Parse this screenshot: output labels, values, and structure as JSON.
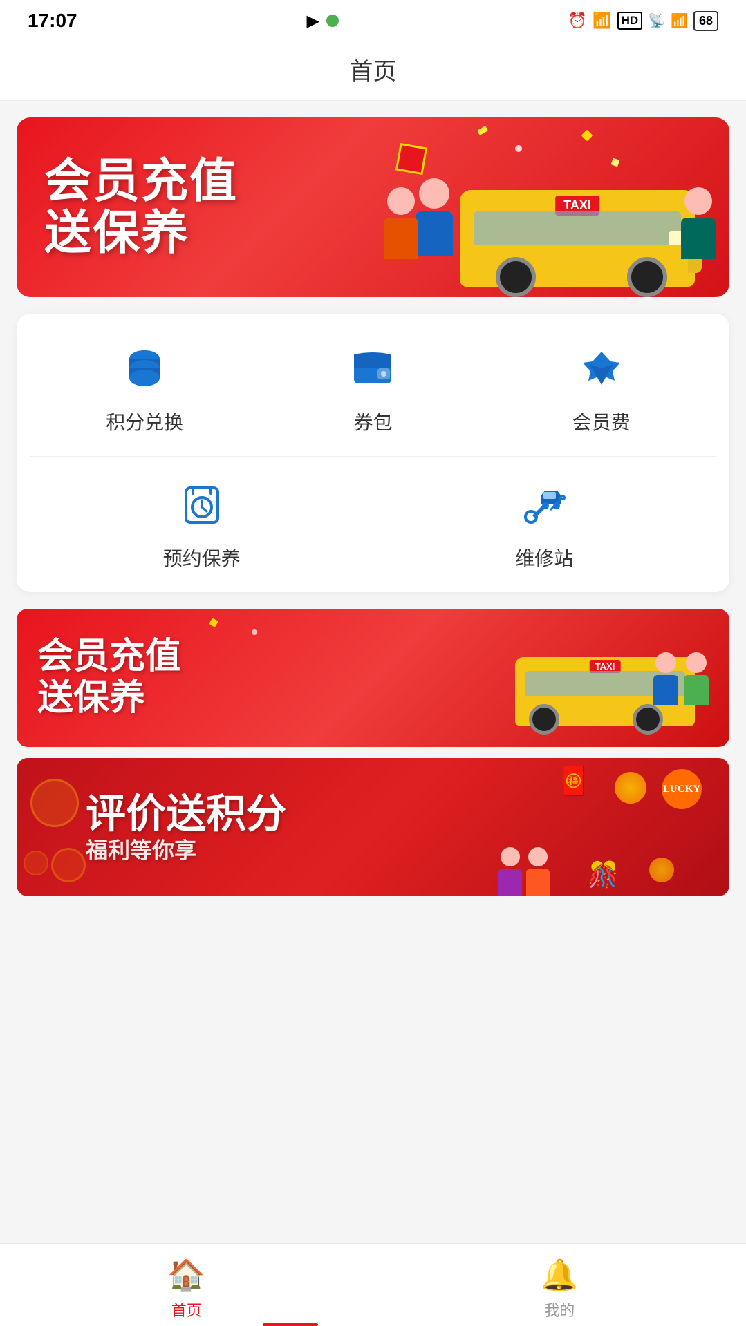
{
  "statusBar": {
    "time": "17:07",
    "battery": "68"
  },
  "header": {
    "title": "首页"
  },
  "banner1": {
    "line1": "会员充值",
    "line2": "送保养"
  },
  "services": {
    "row1": [
      {
        "id": "points",
        "label": "积分兑换",
        "icon": "database"
      },
      {
        "id": "wallet",
        "label": "券包",
        "icon": "wallet"
      },
      {
        "id": "membership",
        "label": "会员费",
        "icon": "diamond"
      }
    ],
    "row2": [
      {
        "id": "maintenance",
        "label": "预约保养",
        "icon": "clock"
      },
      {
        "id": "repair",
        "label": "维修站",
        "icon": "wrench"
      }
    ]
  },
  "promo1": {
    "line1": "会员充值",
    "line2": "送保养"
  },
  "promo2": {
    "text": "评价送积分",
    "subtext": "福利等你享"
  },
  "bottomNav": {
    "items": [
      {
        "id": "home",
        "label": "首页",
        "active": true
      },
      {
        "id": "mine",
        "label": "我的",
        "active": false
      }
    ]
  }
}
